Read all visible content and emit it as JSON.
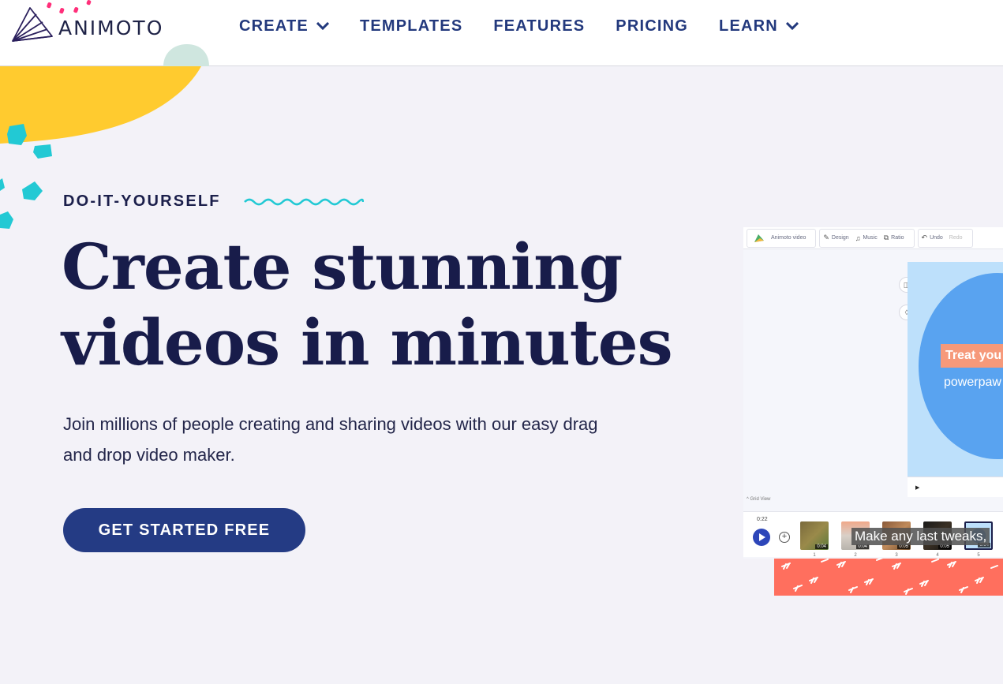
{
  "brand": {
    "name": "ANIMOTO"
  },
  "nav": {
    "items": [
      {
        "label": "CREATE",
        "has_dropdown": true
      },
      {
        "label": "TEMPLATES",
        "has_dropdown": false
      },
      {
        "label": "FEATURES",
        "has_dropdown": false
      },
      {
        "label": "PRICING",
        "has_dropdown": false
      },
      {
        "label": "LEARN",
        "has_dropdown": true
      }
    ]
  },
  "hero": {
    "eyebrow": "DO-IT-YOURSELF",
    "headline_line1": "Create stunning",
    "headline_line2": "videos in minutes",
    "subtext_line1": "Join millions of people creating and sharing videos with our easy drag",
    "subtext_line2": "and drop video maker.",
    "cta_label": "GET STARTED FREE"
  },
  "editor": {
    "toolbar": {
      "project_name": "Animoto video",
      "design": "Design",
      "music": "Music",
      "ratio": "Ratio",
      "undo": "Undo",
      "redo": "Redo"
    },
    "canvas_title": "Treat you",
    "canvas_subtitle": "powerpaw",
    "grid_view": "Grid View",
    "time": "0:22",
    "thumbnails": [
      {
        "num": "1",
        "duration": "0:04"
      },
      {
        "num": "2",
        "duration": "0:04"
      },
      {
        "num": "3",
        "duration": "0:05"
      },
      {
        "num": "4",
        "duration": "0:05"
      },
      {
        "num": "5",
        "duration": "0:04"
      }
    ],
    "caption": "Make any last tweaks,"
  },
  "colors": {
    "accent_blue": "#243b84",
    "headline": "#181c4a",
    "background": "#f3f2f8",
    "yellow": "#ffcb2f",
    "teal": "#22c9d4",
    "coral": "#ff6f5e",
    "pink": "#ff2f7a"
  },
  "icons": [
    "animoto-logo-icon",
    "chevron-down-icon",
    "wave-icon",
    "play-icon",
    "add-icon",
    "undo-icon",
    "design-icon",
    "music-icon",
    "ratio-icon"
  ]
}
